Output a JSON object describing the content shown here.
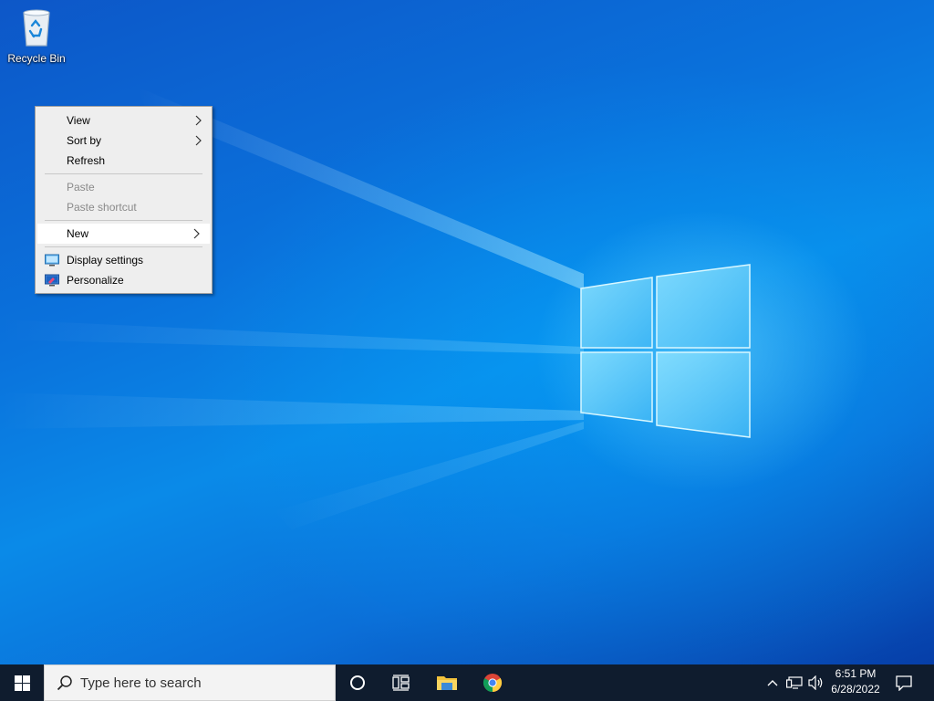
{
  "desktop": {
    "icons": [
      {
        "label": "Recycle Bin",
        "icon": "recycle-bin-icon"
      }
    ]
  },
  "context_menu": {
    "groups": [
      [
        {
          "label": "View",
          "submenu": true,
          "enabled": true
        },
        {
          "label": "Sort by",
          "submenu": true,
          "enabled": true
        },
        {
          "label": "Refresh",
          "submenu": false,
          "enabled": true
        }
      ],
      [
        {
          "label": "Paste",
          "submenu": false,
          "enabled": false
        },
        {
          "label": "Paste shortcut",
          "submenu": false,
          "enabled": false
        }
      ],
      [
        {
          "label": "New",
          "submenu": true,
          "enabled": true,
          "highlighted": true
        }
      ],
      [
        {
          "label": "Display settings",
          "icon": "display-settings-icon",
          "enabled": true
        },
        {
          "label": "Personalize",
          "icon": "personalize-icon",
          "enabled": true
        }
      ]
    ]
  },
  "taskbar": {
    "start_icon": "windows-logo-icon",
    "search_placeholder": "Type here to search",
    "pinned": [
      {
        "name": "cortana",
        "icon": "cortana-circle-icon"
      },
      {
        "name": "task-view",
        "icon": "task-view-icon"
      },
      {
        "name": "file-explorer",
        "icon": "folder-icon"
      },
      {
        "name": "chrome",
        "icon": "chrome-icon"
      }
    ],
    "tray": {
      "icons": [
        "chevron-up-icon",
        "network-icon",
        "volume-icon"
      ],
      "time": "6:51 PM",
      "date": "6/28/2022",
      "notification_icon": "notification-icon"
    }
  },
  "colors": {
    "taskbar_bg": "#0f1c2e",
    "menu_bg": "#eeeeee",
    "menu_disabled_text": "#8a8a8a",
    "desktop_blue": "#0a72dc"
  }
}
